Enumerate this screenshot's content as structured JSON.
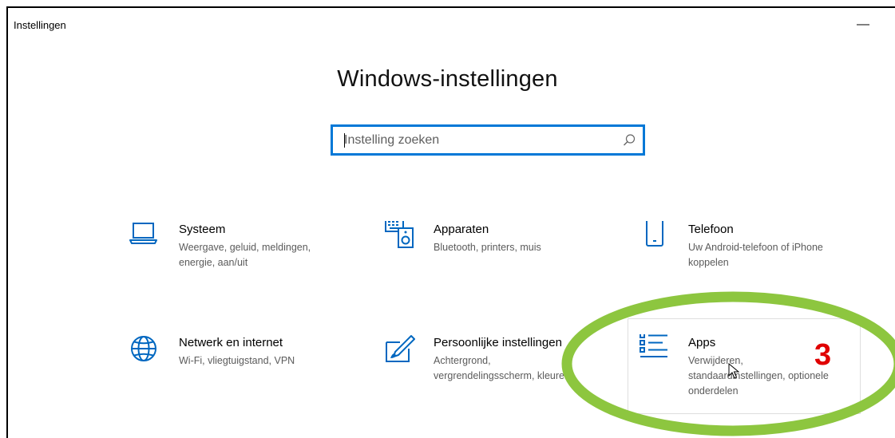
{
  "window": {
    "title": "Instellingen",
    "minimize_glyph": "—"
  },
  "page": {
    "title": "Windows-instellingen"
  },
  "search": {
    "placeholder": "Instelling zoeken",
    "value": ""
  },
  "tiles": [
    {
      "id": "systeem",
      "title": "Systeem",
      "desc_line1": "Weergave, geluid, meldingen,",
      "desc_line2": "energie, aan/uit",
      "icon": "laptop-icon"
    },
    {
      "id": "apparaten",
      "title": "Apparaten",
      "desc_line1": "Bluetooth, printers, muis",
      "desc_line2": "",
      "icon": "devices-icon"
    },
    {
      "id": "telefoon",
      "title": "Telefoon",
      "desc_line1": "Uw Android-telefoon of iPhone",
      "desc_line2": "koppelen",
      "icon": "phone-icon"
    },
    {
      "id": "netwerk",
      "title": "Netwerk en internet",
      "desc_line1": "Wi-Fi, vliegtuigstand, VPN",
      "desc_line2": "",
      "icon": "globe-icon"
    },
    {
      "id": "persoonlijk",
      "title": "Persoonlijke instellingen",
      "desc_line1": "Achtergrond,",
      "desc_line2": "vergrendelingsscherm, kleuren",
      "icon": "personalization-icon"
    },
    {
      "id": "apps",
      "title": "Apps",
      "desc_line1": "Verwijderen,",
      "desc_line2": "standaardinstellingen, optionele",
      "desc_line3": "onderdelen",
      "icon": "apps-list-icon"
    }
  ],
  "annotation": {
    "number": "3",
    "ring_color": "#8dc63f",
    "number_color": "#e00000"
  },
  "colors": {
    "accent": "#0078d7",
    "icon_blue": "#0067c0"
  }
}
